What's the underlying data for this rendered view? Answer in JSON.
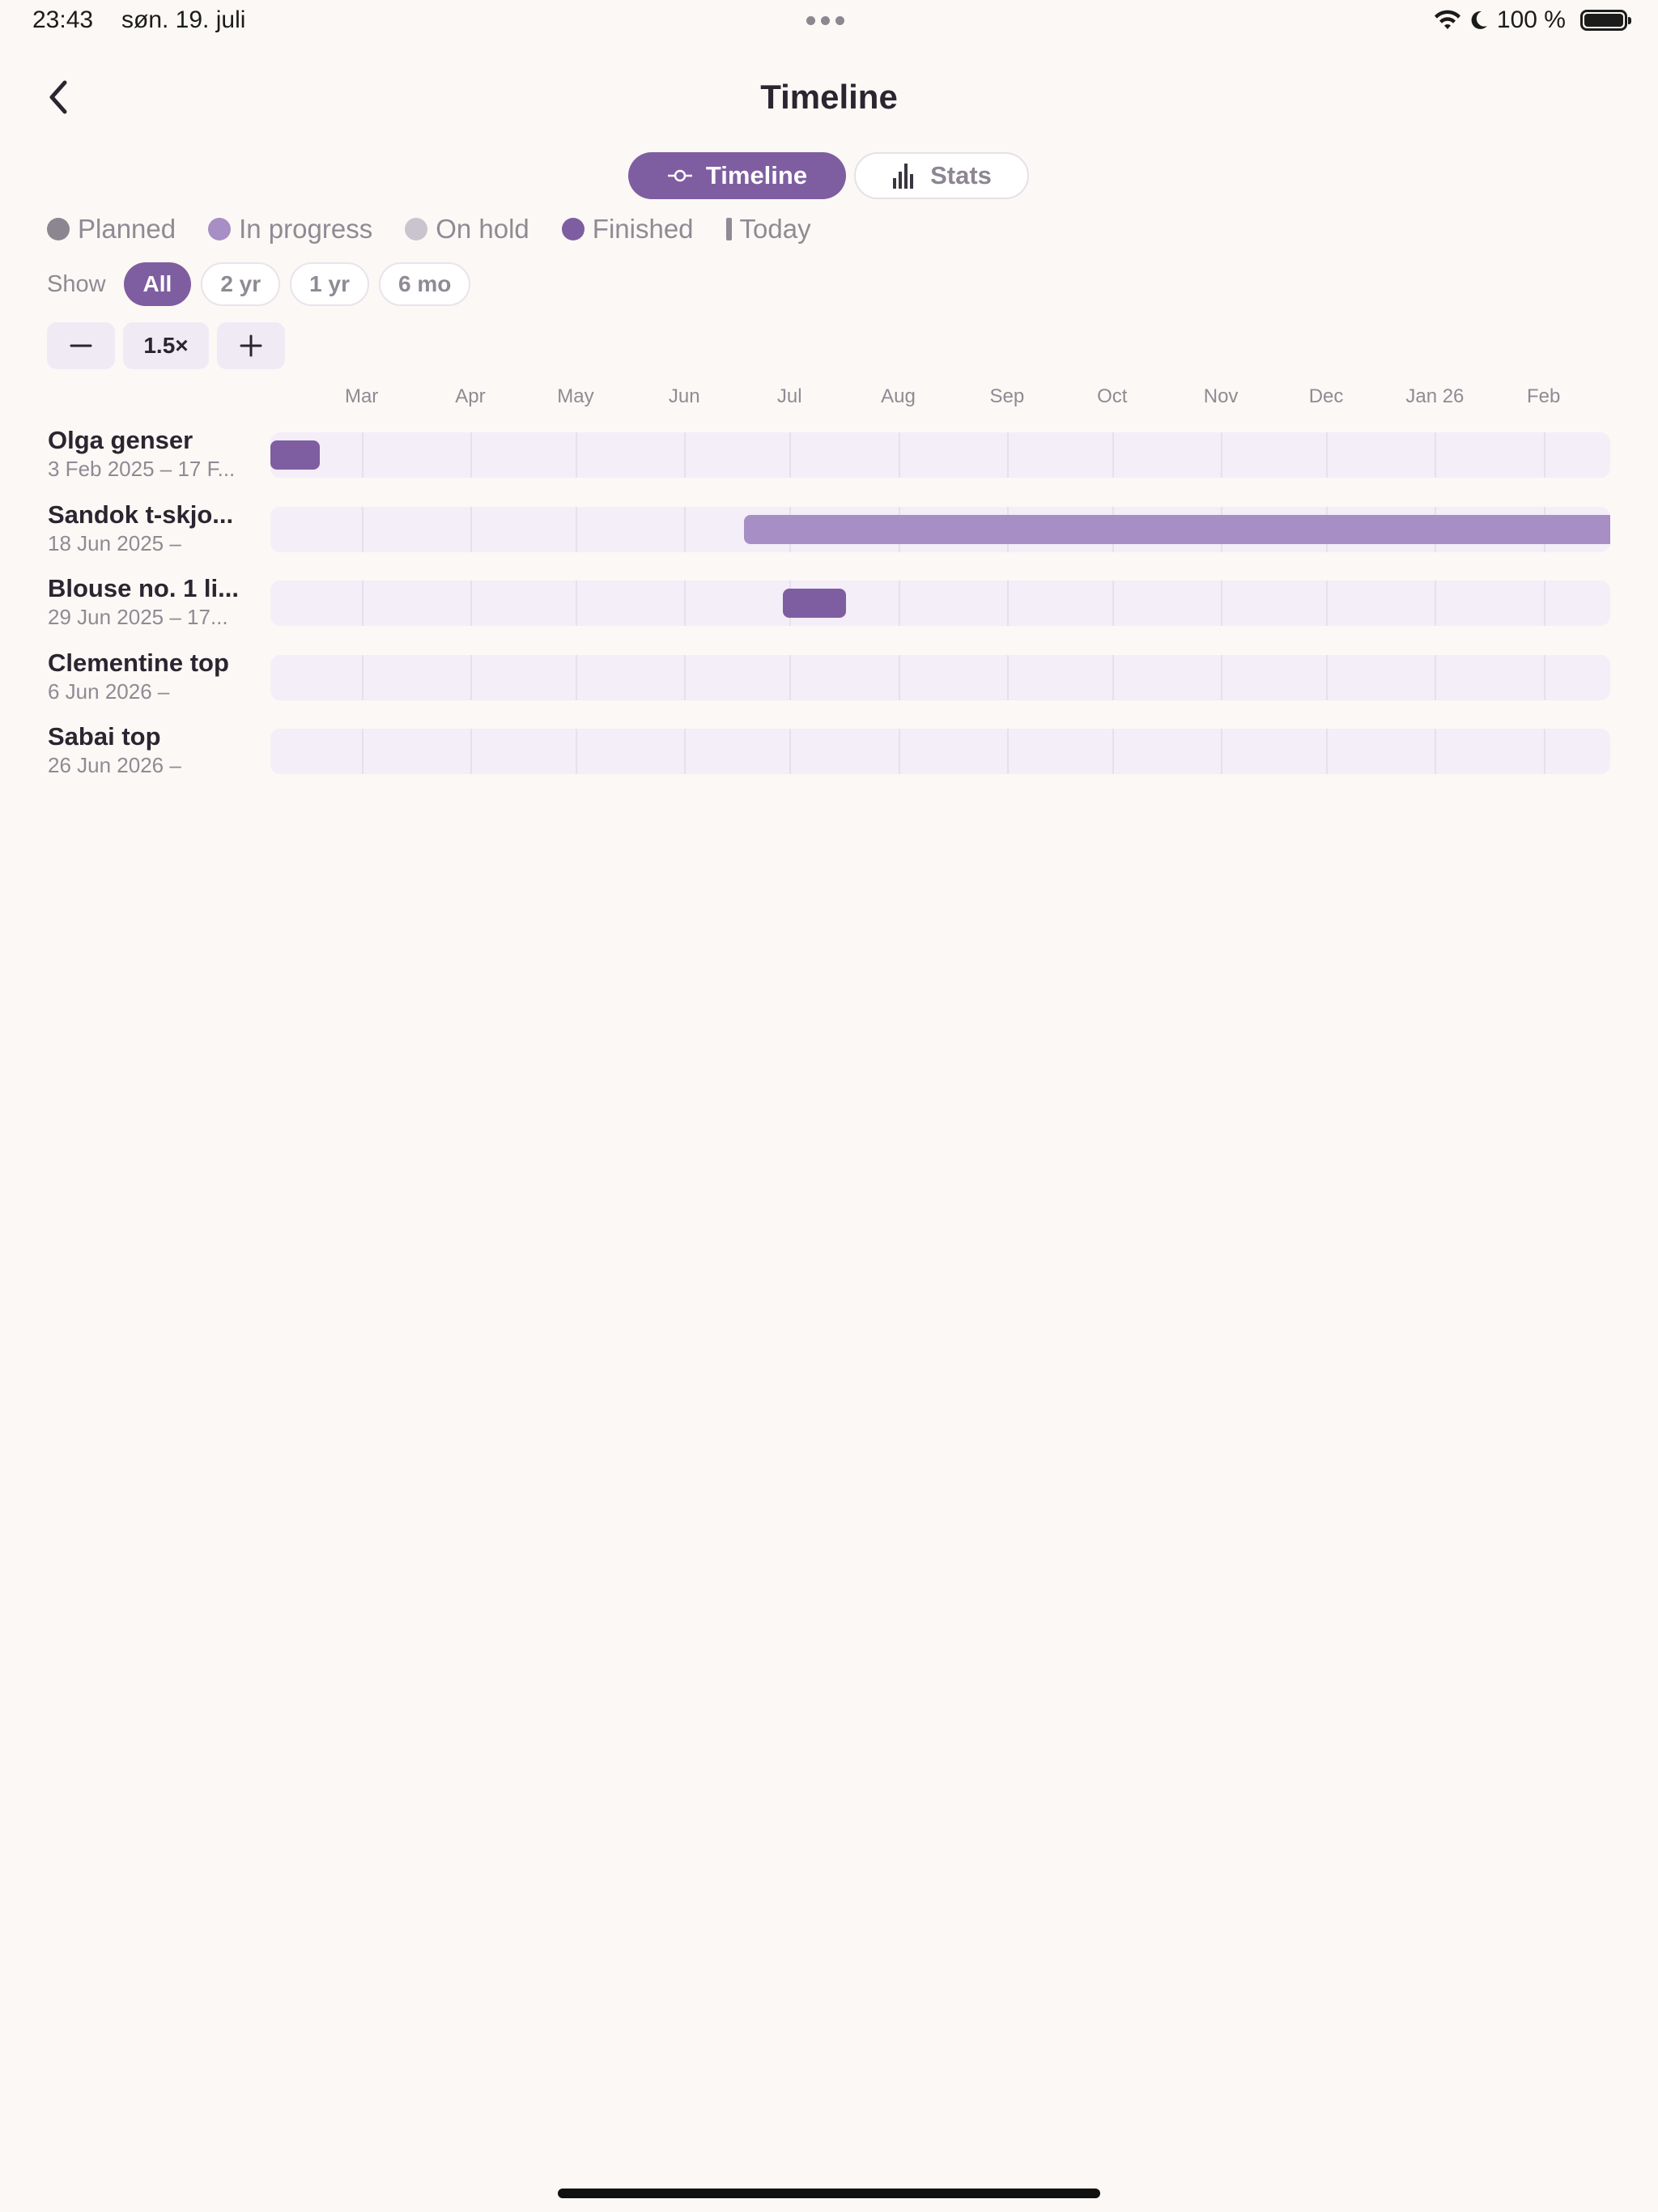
{
  "status_bar": {
    "time": "23:43",
    "date": "søn. 19. juli",
    "battery": "100 %"
  },
  "header": {
    "title": "Timeline"
  },
  "segmented": {
    "timeline_label": "Timeline",
    "stats_label": "Stats"
  },
  "legend": {
    "items": [
      {
        "label": "Planned",
        "color": "#8B8690"
      },
      {
        "label": "In progress",
        "color": "#A78EC4"
      },
      {
        "label": "On hold",
        "color": "#C9C4CD"
      },
      {
        "label": "Finished",
        "color": "#7E5EA0"
      }
    ],
    "today_label": "Today"
  },
  "range": {
    "label": "Show",
    "options": [
      "All",
      "2 yr",
      "1 yr",
      "6 mo"
    ],
    "selected": "All"
  },
  "zoom": {
    "level": "1.5×"
  },
  "chart_data": {
    "type": "timeline",
    "x_start": "2025-02-03",
    "x_end": "2026-02-20",
    "months": [
      {
        "label": "Mar",
        "date": "2025-03-01"
      },
      {
        "label": "Apr",
        "date": "2025-04-01"
      },
      {
        "label": "May",
        "date": "2025-05-01"
      },
      {
        "label": "Jun",
        "date": "2025-06-01"
      },
      {
        "label": "Jul",
        "date": "2025-07-01"
      },
      {
        "label": "Aug",
        "date": "2025-08-01"
      },
      {
        "label": "Sep",
        "date": "2025-09-01"
      },
      {
        "label": "Oct",
        "date": "2025-10-01"
      },
      {
        "label": "Nov",
        "date": "2025-11-01"
      },
      {
        "label": "Dec",
        "date": "2025-12-01"
      },
      {
        "label": "Jan 26",
        "date": "2026-01-01"
      },
      {
        "label": "Feb",
        "date": "2026-02-01"
      }
    ],
    "projects": [
      {
        "name": "Olga genser",
        "date_text": "3 Feb 2025 – 17 F...",
        "start": "2025-02-03",
        "end": "2025-02-17",
        "status": "Finished"
      },
      {
        "name": "Sandok t-skjo...",
        "date_text": "18 Jun 2025 –",
        "start": "2025-06-18",
        "end": null,
        "status": "In progress"
      },
      {
        "name": "Blouse no. 1 li...",
        "date_text": "29 Jun 2025 – 17...",
        "start": "2025-06-29",
        "end": "2025-07-17",
        "status": "Finished"
      },
      {
        "name": "Clementine top",
        "date_text": "6 Jun 2026 –",
        "start": "2026-06-06",
        "end": null,
        "status": "Planned"
      },
      {
        "name": "Sabai top",
        "date_text": "26 Jun 2026 –",
        "start": "2026-06-26",
        "end": null,
        "status": "Planned"
      }
    ]
  }
}
